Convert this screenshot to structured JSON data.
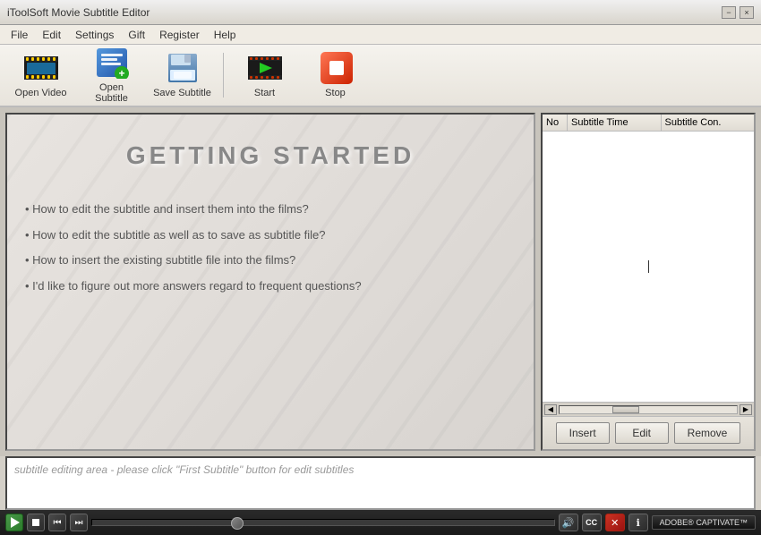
{
  "window": {
    "title": "iToolSoft Movie Subtitle Editor"
  },
  "titlebar": {
    "minimize_label": "−",
    "close_label": "×"
  },
  "menu": {
    "items": [
      "File",
      "Edit",
      "Settings",
      "Gift",
      "Register",
      "Help"
    ]
  },
  "toolbar": {
    "open_video_label": "Open Video",
    "open_subtitle_label": "Open Subtitle",
    "save_subtitle_label": "Save Subtitle",
    "start_label": "Start",
    "stop_label": "Stop"
  },
  "getting_started": {
    "title": "GETTING  STARTED",
    "items": [
      "How to edit the subtitle and insert them into the films?",
      "How to edit the subtitle as well as to save as subtitle file?",
      "How to insert the existing subtitle file into the films?",
      "I'd like to figure out more answers regard to frequent questions?"
    ]
  },
  "subtitle_table": {
    "col_no": "No",
    "col_time": "Subtitle Time",
    "col_content": "Subtitle Con."
  },
  "action_buttons": {
    "insert_label": "Insert",
    "edit_label": "Edit",
    "remove_label": "Remove"
  },
  "subtitle_edit": {
    "placeholder": "subtitle editing area - please click \"First Subtitle\" button for edit subtitles"
  },
  "playback": {
    "captivate_text": "ADOBE® CAPTIVATE™"
  },
  "colors": {
    "toolbar_bg": "#f5f3ee",
    "panel_bg": "#c8c4bc",
    "accent_green": "#22aa22",
    "accent_red": "#cc3322"
  }
}
